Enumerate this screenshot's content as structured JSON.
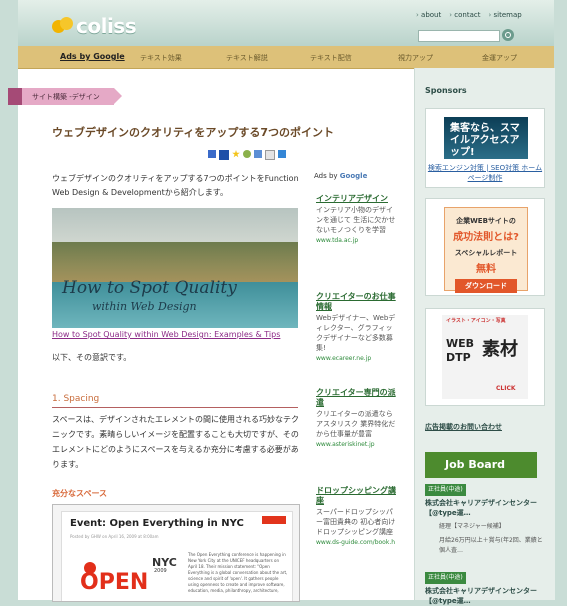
{
  "header": {
    "logo": "coliss",
    "links": [
      "about",
      "contact",
      "sitemap"
    ]
  },
  "adsbar": {
    "lead": "Ads by Google",
    "items": [
      "テキスト効果",
      "テキスト解説",
      "テキスト配信",
      "視力アップ",
      "金運アップ"
    ]
  },
  "article": {
    "category": "サイト構築 -デザイン",
    "title": "ウェブデザインのクオリティをアップする7つのポイント",
    "intro": "ウェブデザインのクオリティをアップする7つのポイントをFunction Web Design & Developmentから紹介します。",
    "photo_title": "How to Spot Quality",
    "photo_sub": "within Web Design",
    "caption": "How to Spot Quality within Web Design: Examples & Tips",
    "lead2": "以下、その意訳です。",
    "section1": "1. Spacing",
    "section1_text": "スペースは、デザインされたエレメントの間に使用される巧妙なテクニックです。素晴らしいイメージを配置することも大切ですが、そのエレメントにどのようにスペースを与えるか充分に考慮する必要があります。",
    "sub1": "充分なスペース",
    "shot": {
      "title": "Event: Open Everything in NYC",
      "meta": "Posted by GHW on April 16, 2009 at 8:00am",
      "nyc": "NYC",
      "year": "2009",
      "open": "OPEN",
      "desc": "The Open Everything conference is happening in New York City at the UNICEF headquarters on April 18. Their mission statement: \"Open Everything is a global conversation about the art, science and spirit of 'open'. It gathers people using openness to create and improve software, education, media, philanthropy, architecture,"
    }
  },
  "ads": {
    "label": "Ads by ",
    "brand": "Google",
    "items": [
      {
        "title": "インテリアデザイン",
        "desc": "インテリア小物のデザインを通じて 生活に欠かせないモノつくりを学習",
        "url": "www.tda.ac.jp"
      },
      {
        "title": "クリエイターのお仕事情報",
        "desc": "Webデザイナー、Webディレクター、グラフィックデザイナーなど多数募集!",
        "url": "www.ecareer.ne.jp"
      },
      {
        "title": "クリエイター専門の派遣",
        "desc": "クリエイターの派遣ならアスタリスク 業界特化だから仕事量が豊富",
        "url": "www.asteriskinet.jp"
      },
      {
        "title": "ドロップシッピング講座",
        "desc": "スーパードロップシッパー富田貴典の 初心者向けドロップシッピング講座",
        "url": "www.ds-guide.com/book.h"
      }
    ]
  },
  "sidebar": {
    "heading": "Sponsors",
    "banner1_img": "集客なら、スマイルアクセスアップ!",
    "banner1_text": "検索エンジン対策 | SEO対策 ホームページ制作",
    "banner2": [
      "企業WEBサイトの",
      "成功法則とは?",
      "スペシャルレポート",
      "無料",
      "ダウンロード"
    ],
    "banner3": [
      "イラスト・アイコン・写真",
      "WEB",
      "DTP",
      "素材",
      "CLICK"
    ],
    "contact_link": "広告掲載のお問い合わせ",
    "jobboard": "Job Board",
    "jobs": [
      {
        "tag": "正社員(中途)",
        "name": "株式会社キャリアデザインセンター【@type運…",
        "lines": [
          "経理【マネジャー候補】",
          "月給26万円以上＋賞与(年2回、業績と個人査…"
        ]
      },
      {
        "tag": "正社員(中途)",
        "name": "株式会社キャリアデザインセンター【@type運…",
        "lines": []
      }
    ]
  }
}
